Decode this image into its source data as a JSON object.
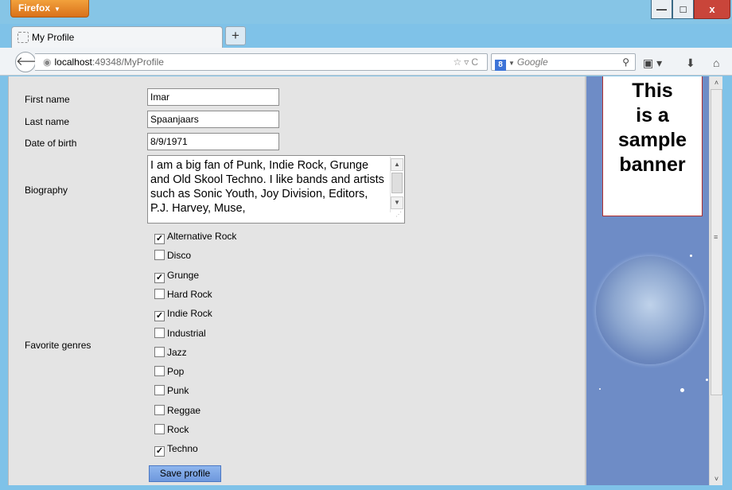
{
  "browser": {
    "menu_button": "Firefox",
    "tab_title": "My Profile",
    "new_tab": "+",
    "url_host": "localhost",
    "url_path": ":49348/MyProfile",
    "search_engine_badge": "8",
    "search_placeholder": "Google",
    "window_controls": {
      "minimize": "—",
      "maximize": "□",
      "close": "x"
    }
  },
  "form": {
    "first_name_label": "First name",
    "first_name_value": "Imar",
    "last_name_label": "Last name",
    "last_name_value": "Spaanjaars",
    "dob_label": "Date of birth",
    "dob_value": "8/9/1971",
    "biography_label": "Biography",
    "biography_value": "I am a big fan of Punk, Indie Rock, Grunge and Old Skool Techno. I like bands and artists such as Sonic Youth, Joy Division, Editors, P.J. Harvey, Muse,",
    "genres_label": "Favorite genres",
    "genres": [
      {
        "label": "Alternative Rock",
        "checked": true
      },
      {
        "label": "Disco",
        "checked": false
      },
      {
        "label": "Grunge",
        "checked": true
      },
      {
        "label": "Hard Rock",
        "checked": false
      },
      {
        "label": "Indie Rock",
        "checked": true
      },
      {
        "label": "Industrial",
        "checked": false
      },
      {
        "label": "Jazz",
        "checked": false
      },
      {
        "label": "Pop",
        "checked": false
      },
      {
        "label": "Punk",
        "checked": false
      },
      {
        "label": "Reggae",
        "checked": false
      },
      {
        "label": "Rock",
        "checked": false
      },
      {
        "label": "Techno",
        "checked": true
      }
    ],
    "save_button": "Save profile"
  },
  "banner": {
    "lines": [
      "This",
      "is a",
      "sample",
      "banner"
    ]
  },
  "colors": {
    "firefox_orange": "#e8892a",
    "banner_blue": "#6e8cc6",
    "button_blue": "#7aa3e4",
    "close_red": "#c9453a"
  }
}
